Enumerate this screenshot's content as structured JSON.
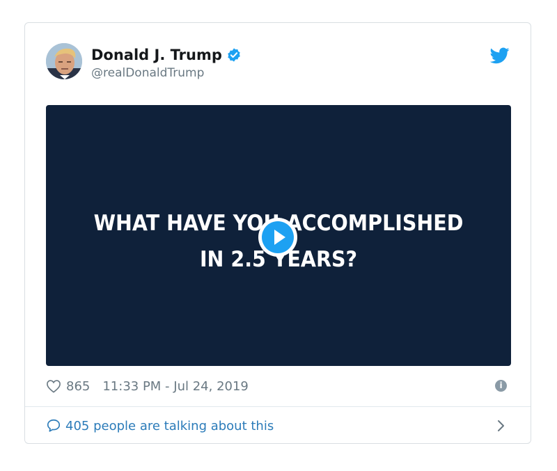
{
  "tweet": {
    "display_name": "Donald J. Trump",
    "handle": "@realDonaldTrump",
    "verified": true,
    "media": {
      "line1": "WHAT HAVE YOU ACCOMPLISHED",
      "line2": "IN 2.5 YEARS?",
      "type": "video"
    },
    "likes": "865",
    "timestamp": "11:33 PM - Jul 24, 2019",
    "conversation": "405 people are talking about this"
  },
  "icons": {
    "verified": "verified-badge-icon",
    "bird": "twitter-bird-icon",
    "play": "play-icon",
    "heart": "heart-icon",
    "info": "info-icon",
    "bubble": "speech-bubble-icon",
    "chevron": "chevron-right-icon"
  },
  "colors": {
    "twitter_blue": "#1da1f2",
    "media_bg": "#0f213a",
    "link_blue": "#2b7bb9",
    "muted_text": "#697882"
  }
}
